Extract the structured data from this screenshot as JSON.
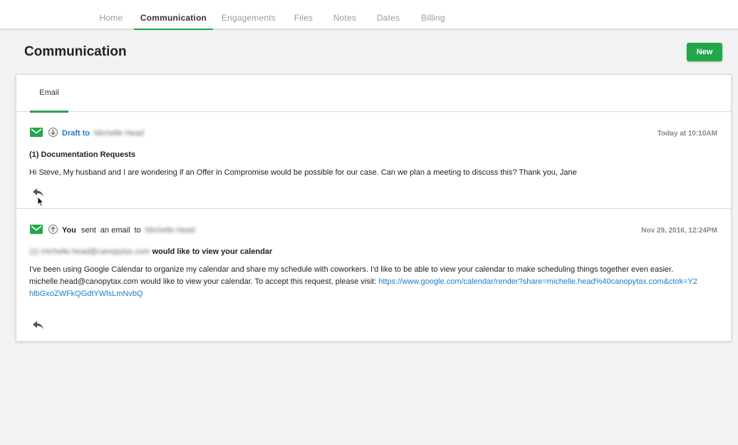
{
  "nav": {
    "tabs": [
      {
        "label": "Home"
      },
      {
        "label": "Communication"
      },
      {
        "label": "Engagements"
      },
      {
        "label": "Files"
      },
      {
        "label": "Notes"
      },
      {
        "label": "Dates"
      },
      {
        "label": "Billing"
      }
    ],
    "active_tab": "Communication"
  },
  "page": {
    "title": "Communication",
    "new_button": "New"
  },
  "card": {
    "tab_label": "Email"
  },
  "messages": [
    {
      "direction_icon": "arrow-down-circle-icon",
      "prefix": "Draft to",
      "recipient_blurred": "Michelle Head",
      "timestamp": "Today at 10:10AM",
      "subject": "(1) Documentation Requests",
      "body": "Hi Steve, My husband and I are wondering if an Offer in Compromise would be possible for our case. Can we plan a meeting to discuss this? Thank you, Jane"
    },
    {
      "direction_icon": "arrow-up-circle-icon",
      "sender": "You",
      "action": "sent  an email  to",
      "recipient_blurred": "Michelle Head",
      "timestamp": "Nov 29, 2016, 12:24PM",
      "subject_blurred": "(1) michelle.head@canopytax.com",
      "subject": "would like to view your calendar",
      "body_line1": "I've been using Google Calendar to organize my calendar and share my schedule with coworkers. I'd like to be able to view your calendar to make scheduling things together even easier.",
      "body_line2": "michelle.head@canopytax.com would like to view your calendar. To accept this request, please visit: ",
      "link": "https://www.google.com/calendar/render?share=michelle.head%40canopytax.com&ctok=Y2hlbGxoZWFkQGdtYWlsLmNvbQ"
    }
  ],
  "colors": {
    "accent": "#21a849",
    "link": "#1d7cc9"
  }
}
